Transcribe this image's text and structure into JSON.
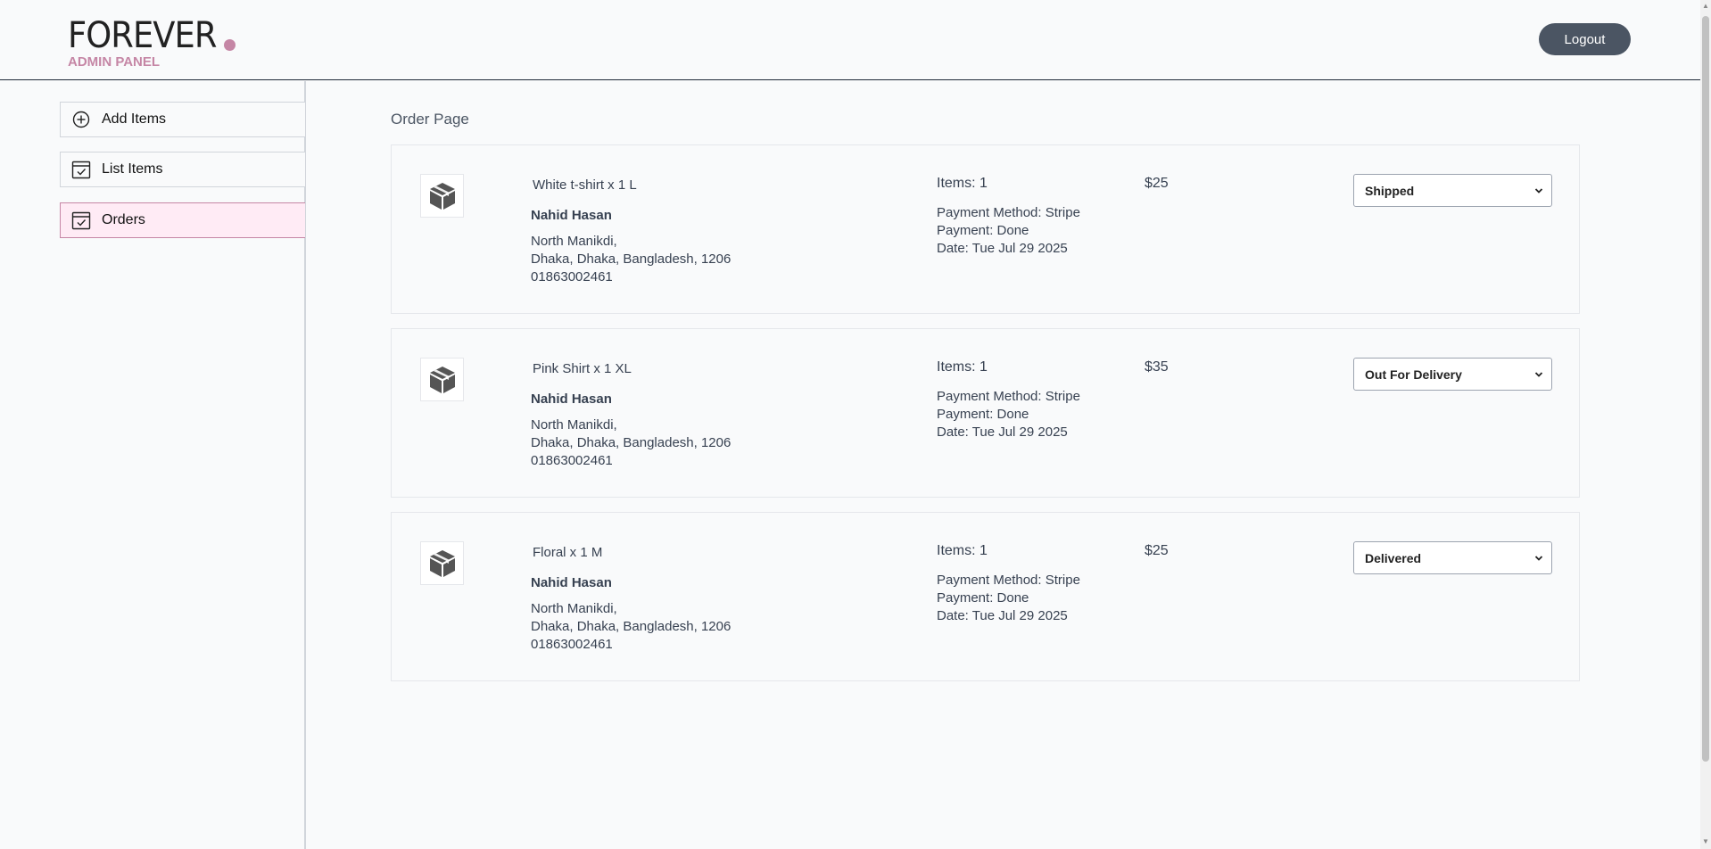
{
  "header": {
    "logo_text": "FOREVER",
    "logo_sub": "ADMIN PANEL",
    "logout_label": "Logout",
    "accent_color": "#c586a5"
  },
  "sidebar": {
    "items": [
      {
        "label": "Add Items",
        "icon": "add-circle-icon",
        "active": false
      },
      {
        "label": "List Items",
        "icon": "calendar-check-icon",
        "active": false
      },
      {
        "label": "Orders",
        "icon": "calendar-check-icon",
        "active": true
      }
    ]
  },
  "main": {
    "title": "Order Page",
    "orders": [
      {
        "item": "White t-shirt x 1 L",
        "customer": "Nahid Hasan",
        "address_line1": "North Manikdi,",
        "address_line2": "Dhaka, Dhaka, Bangladesh, 1206",
        "phone": "01863002461",
        "items_count": "Items: 1",
        "payment_method": "Payment Method: Stripe",
        "payment_status": "Payment: Done",
        "date": "Date: Tue Jul 29 2025",
        "price": "$25",
        "status": "Shipped"
      },
      {
        "item": "Pink Shirt x 1 XL",
        "customer": "Nahid Hasan",
        "address_line1": "North Manikdi,",
        "address_line2": "Dhaka, Dhaka, Bangladesh, 1206",
        "phone": "01863002461",
        "items_count": "Items: 1",
        "payment_method": "Payment Method: Stripe",
        "payment_status": "Payment: Done",
        "date": "Date: Tue Jul 29 2025",
        "price": "$35",
        "status": "Out For Delivery"
      },
      {
        "item": "Floral x 1 M",
        "customer": "Nahid Hasan",
        "address_line1": "North Manikdi,",
        "address_line2": "Dhaka, Dhaka, Bangladesh, 1206",
        "phone": "01863002461",
        "items_count": "Items: 1",
        "payment_method": "Payment Method: Stripe",
        "payment_status": "Payment: Done",
        "date": "Date: Tue Jul 29 2025",
        "price": "$25",
        "status": "Delivered"
      }
    ]
  }
}
